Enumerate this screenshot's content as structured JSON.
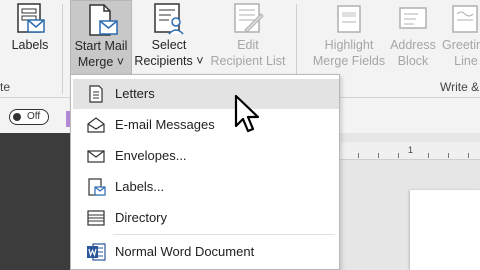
{
  "ribbon": {
    "buttons": {
      "labels": {
        "label": "Labels",
        "icon": "labels-icon"
      },
      "start_mail_merge": {
        "label": "Start Mail\nMerge ˅",
        "icon": "start-mail-merge-icon"
      },
      "select_recipients": {
        "label": "Select\nRecipients ˅",
        "icon": "select-recipients-icon"
      },
      "edit_recipient_list": {
        "label": "Edit\nRecipient List",
        "icon": "edit-recipient-list-icon"
      },
      "highlight_merge_fields": {
        "label": "Highlight\nMerge Fields",
        "icon": "highlight-icon"
      },
      "address_block": {
        "label": "Address\nBlock",
        "icon": "address-block-icon"
      },
      "greeting_line": {
        "label": "Greeting\nLine",
        "icon": "greeting-line-icon"
      }
    },
    "group_left_label": "te",
    "group_right_label": "Write &"
  },
  "toggle": {
    "label": "Off"
  },
  "ruler": {
    "marker": "1"
  },
  "menu": {
    "items": [
      {
        "label": "Letters",
        "icon": "letter-document-icon"
      },
      {
        "label": "E-mail Messages",
        "icon": "email-envelope-icon"
      },
      {
        "label": "Envelopes...",
        "icon": "envelope-icon"
      },
      {
        "label": "Labels...",
        "icon": "label-icon"
      },
      {
        "label": "Directory",
        "icon": "directory-list-icon"
      },
      {
        "label": "Normal Word Document",
        "icon": "word-document-icon"
      }
    ]
  },
  "colors": {
    "ribbon_bg": "#f3f3f3",
    "active_button": "#c8c8c8",
    "menu_hover": "#e3e3e3",
    "word_blue": "#2b579a",
    "accent_purple": "#b48ad8"
  }
}
